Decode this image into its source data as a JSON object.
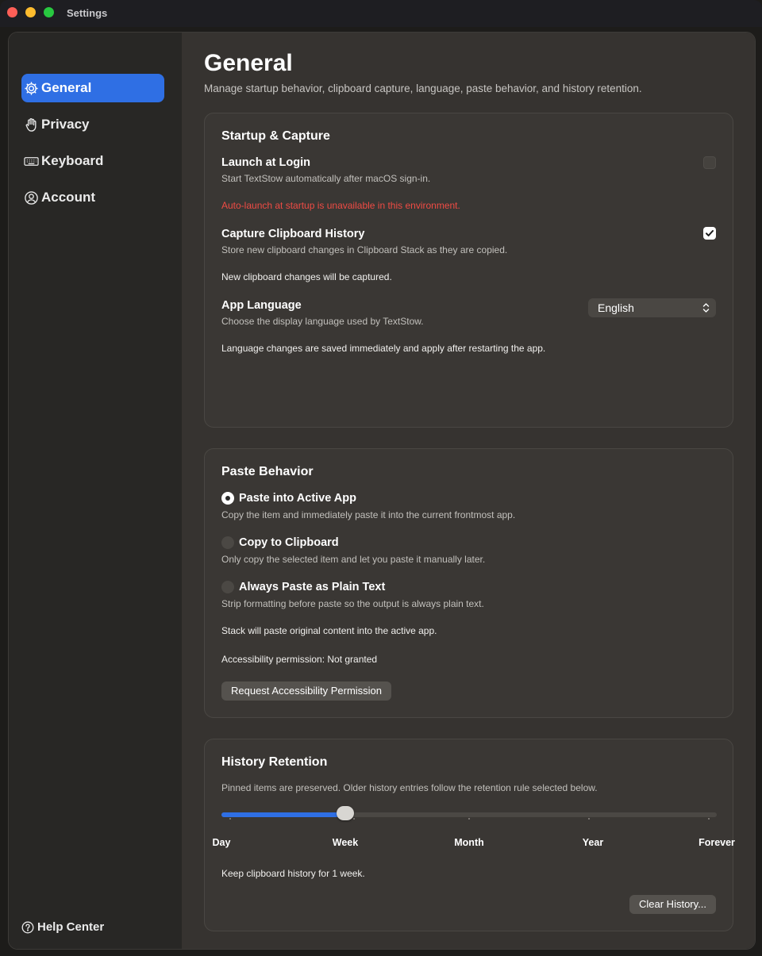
{
  "window": {
    "title": "Settings"
  },
  "sidebar": {
    "items": [
      {
        "label": "General",
        "icon": "gear-icon",
        "active": true
      },
      {
        "label": "Privacy",
        "icon": "hand-icon",
        "active": false
      },
      {
        "label": "Keyboard",
        "icon": "keyboard-icon",
        "active": false
      },
      {
        "label": "Account",
        "icon": "person-circle-icon",
        "active": false
      }
    ],
    "help": "Help Center"
  },
  "main": {
    "title": "General",
    "subtitle": "Manage startup behavior, clipboard capture, language, paste behavior, and history retention."
  },
  "startup": {
    "title": "Startup & Capture",
    "launch": {
      "title": "Launch at Login",
      "desc": "Start TextStow automatically after macOS sign-in.",
      "checked": false,
      "warning": "Auto-launch at startup is unavailable in this environment."
    },
    "capture": {
      "title": "Capture Clipboard History",
      "desc": "Store new clipboard changes in Clipboard Stack as they are copied.",
      "checked": true,
      "note": "New clipboard changes will be captured."
    },
    "language": {
      "title": "App Language",
      "desc": "Choose the display language used by TextStow.",
      "value": "English",
      "note": "Language changes are saved immediately and apply after restarting the app."
    }
  },
  "paste": {
    "title": "Paste Behavior",
    "options": [
      {
        "label": "Paste into Active App",
        "desc": "Copy the item and immediately paste it into the current frontmost app.",
        "selected": true
      },
      {
        "label": "Copy to Clipboard",
        "desc": "Only copy the selected item and let you paste it manually later.",
        "selected": false
      },
      {
        "label": "Always Paste as Plain Text",
        "desc": "Strip formatting before paste so the output is always plain text.",
        "selected": false
      }
    ],
    "status": "Stack will paste original content into the active app.",
    "permission": "Accessibility permission: Not granted",
    "request_button": "Request Accessibility Permission"
  },
  "history": {
    "title": "History Retention",
    "desc": "Pinned items are preserved. Older history entries follow the retention rule selected below.",
    "stops": [
      "Day",
      "Week",
      "Month",
      "Year",
      "Forever"
    ],
    "selected_index": 1,
    "note": "Keep clipboard history for 1 week.",
    "clear_button": "Clear History..."
  },
  "colors": {
    "accent": "#2f6fe4",
    "warning": "#ef4b44",
    "sidebar": "#282725",
    "content": "#363330"
  }
}
